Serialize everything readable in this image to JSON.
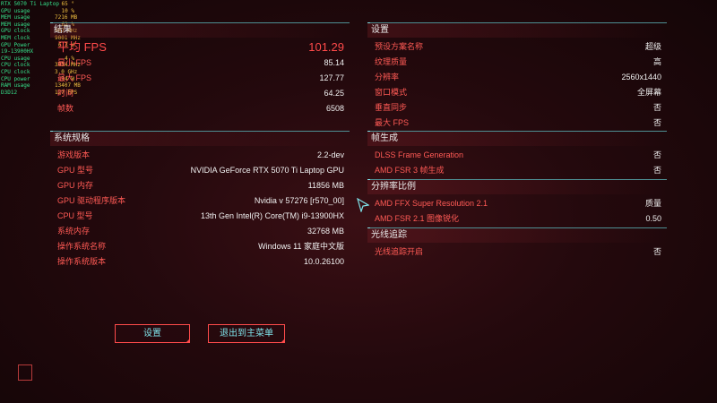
{
  "overlay": {
    "rows": [
      {
        "label": "RTX 5070 Ti Laptop",
        "value": "65 °"
      },
      {
        "label": "GPU usage",
        "value": "10 %"
      },
      {
        "label": "MEM usage",
        "value": "7216 MB"
      },
      {
        "label": "MEM usage",
        "value": "62 %"
      },
      {
        "label": "GPU clock",
        "value": "987 MHz"
      },
      {
        "label": "MEM clock",
        "value": "9001 MHz"
      },
      {
        "label": "GPU Power",
        "value": "6.3 W"
      },
      {
        "label": "i9-13900HX",
        "value": ""
      },
      {
        "label": "CPU usage",
        "value": "4 %"
      },
      {
        "label": "CPU clock",
        "value": "3034 MHz"
      },
      {
        "label": "CPU clock",
        "value": "3.0 GHz"
      },
      {
        "label": "CPU power",
        "value": "14 W"
      },
      {
        "label": "RAM usage",
        "value": "13407 MB"
      },
      {
        "label": "D3D12",
        "value": "127 FPS"
      }
    ]
  },
  "left_top": {
    "header": "结果",
    "rows": [
      {
        "label": "平均 FPS",
        "value": "101.29",
        "big": true
      },
      {
        "label": "最小 FPS",
        "value": "85.14"
      },
      {
        "label": "最大 FPS",
        "value": "127.77"
      },
      {
        "label": "时间",
        "value": "64.25"
      },
      {
        "label": "帧数",
        "value": "6508"
      }
    ]
  },
  "left_bottom": {
    "header": "系统规格",
    "rows": [
      {
        "label": "游戏版本",
        "value": "2.2-dev"
      },
      {
        "label": "GPU 型号",
        "value": "NVIDIA GeForce RTX 5070 Ti Laptop GPU"
      },
      {
        "label": "GPU 内存",
        "value": "11856 MB"
      },
      {
        "label": "GPU 驱动程序版本",
        "value": "Nvidia v 57276 [r570_00]"
      },
      {
        "label": "CPU 型号",
        "value": "13th Gen Intel(R) Core(TM) i9-13900HX"
      },
      {
        "label": "系统内存",
        "value": "32768 MB"
      },
      {
        "label": "操作系统名称",
        "value": "Windows 11 家庭中文版"
      },
      {
        "label": "操作系统版本",
        "value": "10.0.26100"
      }
    ]
  },
  "settings": {
    "header": "设置",
    "rows": [
      {
        "label": "预设方案名称",
        "value": "超级"
      },
      {
        "label": "纹理质量",
        "value": "高"
      },
      {
        "label": "分辨率",
        "value": "2560x1440"
      },
      {
        "label": "窗口模式",
        "value": "全屏幕"
      },
      {
        "label": "垂直同步",
        "value": "否"
      },
      {
        "label": "最大 FPS",
        "value": "否"
      }
    ]
  },
  "frame_gen": {
    "header": "帧生成",
    "rows": [
      {
        "label": "DLSS Frame Generation",
        "value": "否"
      },
      {
        "label": "AMD FSR 3 帧生成",
        "value": "否"
      }
    ]
  },
  "res_scale": {
    "header": "分辨率比例",
    "rows": [
      {
        "label": "AMD FFX Super Resolution 2.1",
        "value": "质量"
      },
      {
        "label": "AMD FSR 2.1 图像锐化",
        "value": "0.50"
      }
    ]
  },
  "raytracing": {
    "header": "光线追踪",
    "rows": [
      {
        "label": "光线追踪开启",
        "value": "否"
      }
    ]
  },
  "buttons": {
    "settings": "设置",
    "exit": "退出到主菜单"
  },
  "colors": {
    "accent_red": "#ff5a55",
    "cyan": "#7fe3ea",
    "overlay_green": "#35e08a"
  }
}
